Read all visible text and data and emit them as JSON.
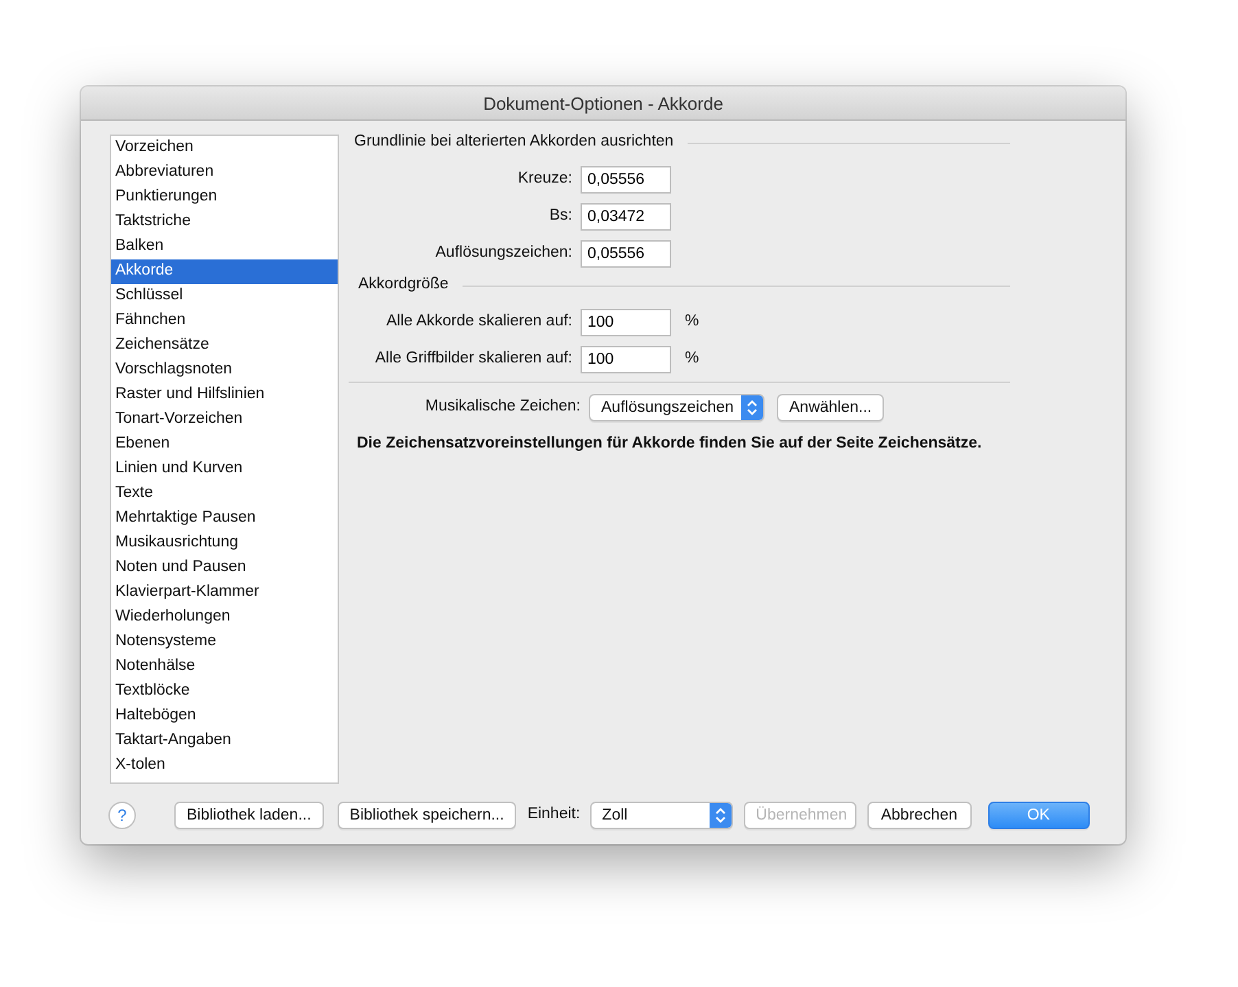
{
  "window": {
    "title": "Dokument-Optionen - Akkorde"
  },
  "sidebar": {
    "items": [
      {
        "label": "Vorzeichen",
        "selected": false
      },
      {
        "label": "Abbreviaturen",
        "selected": false
      },
      {
        "label": "Punktierungen",
        "selected": false
      },
      {
        "label": "Taktstriche",
        "selected": false
      },
      {
        "label": "Balken",
        "selected": false
      },
      {
        "label": "Akkorde",
        "selected": true
      },
      {
        "label": "Schlüssel",
        "selected": false
      },
      {
        "label": "Fähnchen",
        "selected": false
      },
      {
        "label": "Zeichensätze",
        "selected": false
      },
      {
        "label": "Vorschlagsnoten",
        "selected": false
      },
      {
        "label": "Raster und Hilfslinien",
        "selected": false
      },
      {
        "label": "Tonart-Vorzeichen",
        "selected": false
      },
      {
        "label": "Ebenen",
        "selected": false
      },
      {
        "label": "Linien und Kurven",
        "selected": false
      },
      {
        "label": "Texte",
        "selected": false
      },
      {
        "label": "Mehrtaktige Pausen",
        "selected": false
      },
      {
        "label": "Musikausrichtung",
        "selected": false
      },
      {
        "label": "Noten und Pausen",
        "selected": false
      },
      {
        "label": "Klavierpart-Klammer",
        "selected": false
      },
      {
        "label": "Wiederholungen",
        "selected": false
      },
      {
        "label": "Notensysteme",
        "selected": false
      },
      {
        "label": "Notenhälse",
        "selected": false
      },
      {
        "label": "Textblöcke",
        "selected": false
      },
      {
        "label": "Haltebögen",
        "selected": false
      },
      {
        "label": "Taktart-Angaben",
        "selected": false
      },
      {
        "label": "X-tolen",
        "selected": false
      }
    ]
  },
  "baseline": {
    "heading": "Grundlinie bei alterierten Akkorden ausrichten",
    "fields": [
      {
        "label": "Kreuze:",
        "value": "0,05556"
      },
      {
        "label": "Bs:",
        "value": "0,03472"
      },
      {
        "label": "Auflösungszeichen:",
        "value": "0,05556"
      }
    ]
  },
  "size": {
    "heading": "Akkordgröße",
    "fields": [
      {
        "label": "Alle Akkorde skalieren auf:",
        "value": "100",
        "unit": "%"
      },
      {
        "label": "Alle Griffbilder skalieren auf:",
        "value": "100",
        "unit": "%"
      }
    ]
  },
  "symbols": {
    "label": "Musikalische Zeichen:",
    "value": "Auflösungszeichen",
    "button": "Anwählen..."
  },
  "note": "Die Zeichensatzvoreinstellungen für Akkorde finden Sie auf der Seite Zeichensätze.",
  "footer": {
    "help": "?",
    "library_buttons": [
      {
        "label": "Bibliothek laden..."
      },
      {
        "label": "Bibliothek speichern..."
      }
    ],
    "unit": {
      "label": "Einheit:",
      "value": "Zoll"
    },
    "buttons": [
      {
        "label": "Übernehmen",
        "disabled": true,
        "default": false
      },
      {
        "label": "Abbrechen",
        "disabled": false,
        "default": false
      },
      {
        "label": "OK",
        "disabled": false,
        "default": true
      }
    ]
  }
}
